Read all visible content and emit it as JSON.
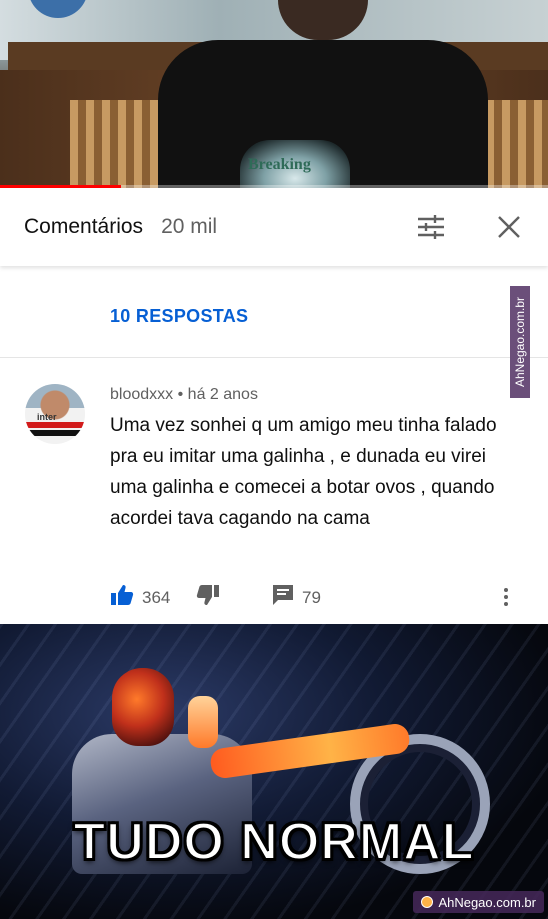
{
  "video": {
    "shirt_print": "Breaking",
    "progress_fraction": 0.22
  },
  "comments_header": {
    "title": "Comentários",
    "count": "20 mil",
    "filter_icon": "sort-icon",
    "close_icon": "close-icon"
  },
  "replies": {
    "label": "10 RESPOSTAS"
  },
  "comment": {
    "author": "bloodxxx",
    "time": "há 2 anos",
    "separator": "•",
    "avatar_jersey_text": "inter",
    "text": "Uma vez sonhei q um amigo meu tinha falado pra eu imitar uma galinha , e dunada eu virei uma galinha e comecei a botar ovos , quando acordei tava cagando na cama",
    "likes": "364",
    "replies_count": "79",
    "icons": {
      "like": "thumbs-up-icon",
      "dislike": "thumbs-down-icon",
      "reply": "comment-icon",
      "more": "more-vert-icon"
    }
  },
  "meme": {
    "caption": "TUDO NORMAL"
  },
  "watermarks": {
    "side": "AhNegao.com.br",
    "bottom": "AhNegao.com.br"
  },
  "colors": {
    "link_blue": "#065fd4",
    "progress_red": "#ff0000",
    "like_blue": "#065fd4",
    "watermark_purple": "#6b4f7a"
  }
}
